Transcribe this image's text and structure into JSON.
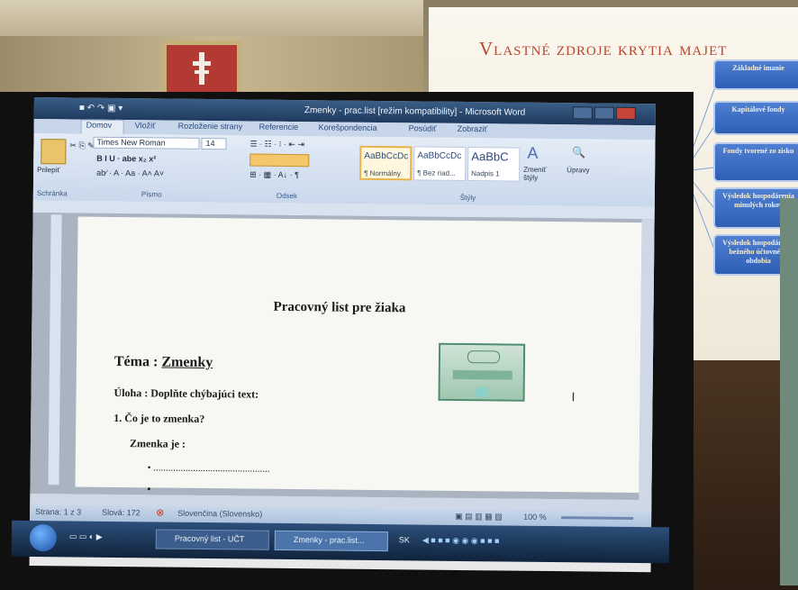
{
  "projection": {
    "title": "Vlastné zdroje krytia majet",
    "boxes": [
      "Základné imanie",
      "Kapitálové fondy",
      "Fondy tvorené zo zisku",
      "Výsledok hospodárenia minulých rokov",
      "Výsledok hospodárenia bežného účtovného obdobia"
    ]
  },
  "word": {
    "title": "Zmenky - prac.list [režim kompatibility] - Microsoft Word",
    "tabs": [
      "Domov",
      "Vložiť",
      "Rozloženie strany",
      "Referencie",
      "Korešpondencia",
      "Posúdiť",
      "Zobraziť"
    ],
    "ribbon": {
      "paste_label": "Prilepiť",
      "font_name": "Times New Roman",
      "font_size": "14",
      "groups": [
        "Schránka",
        "Písmo",
        "Odsek",
        "Štýly"
      ],
      "styles": [
        {
          "sample": "AaBbCcDc",
          "name": "¶ Normálny"
        },
        {
          "sample": "AaBbCcDc",
          "name": "¶ Bez riad..."
        },
        {
          "sample": "AaBbC",
          "name": "Nadpis 1"
        }
      ],
      "change_styles": "Zmeniť štýly",
      "edit": "Úpravy"
    },
    "document": {
      "heading": "Pracovný list pre žiaka",
      "topic_label": "Téma : ",
      "topic": "Zmenky",
      "task": "Úloha : Doplňte chýbajúci text:",
      "question": "1.   Čo je to zmenka?",
      "answer_label": "Zmenka je :",
      "bullet1": "•     ...............................................",
      "bullet2": "•"
    },
    "status": {
      "page": "Strana: 1 z 3",
      "words": "Slová: 172",
      "language": "Slovenčina (Slovensko)",
      "zoom": "100 %"
    },
    "taskbar": {
      "items": [
        "Pracovný list - UČT",
        "Zmenky - prac.list..."
      ],
      "lang": "SK"
    }
  },
  "colors": {
    "accent_title": "#b6462e",
    "ribbon": "#c9d8ec",
    "box": "#2f5fb5"
  }
}
